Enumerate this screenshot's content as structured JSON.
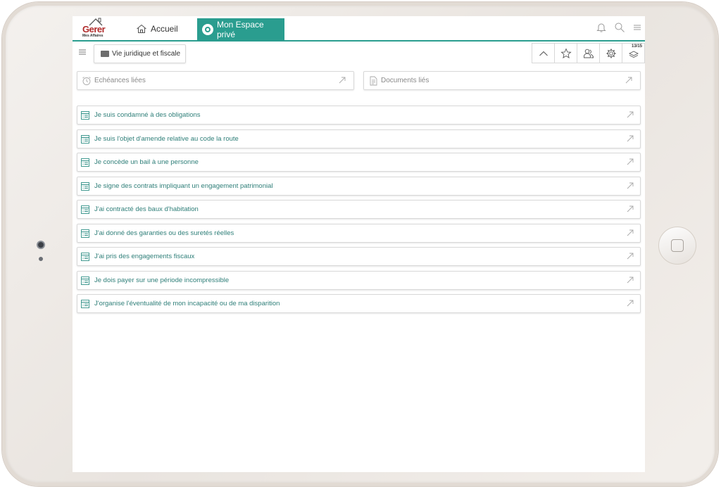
{
  "logo": {
    "brand": "Gerer",
    "tagline": "Mes Affaires"
  },
  "header": {
    "home_label": "Accueil",
    "private_label": "Mon Espace privé",
    "accent_color": "#2a9d8f",
    "icons": [
      "bell-icon",
      "search-icon",
      "hamburger-icon"
    ]
  },
  "toolbar": {
    "breadcrumb": "Vie juridique et fiscale",
    "tools": [
      "chevron-up-icon",
      "star-icon",
      "users-icon",
      "gear-icon",
      "stack-icon"
    ],
    "counter": "13/15"
  },
  "linked": {
    "echeances": "Echéances liées",
    "documents": "Documents liés"
  },
  "items": [
    {
      "label": "Je suis condamné à des obligations"
    },
    {
      "label": "Je suis l'objet d'amende relative au code la route"
    },
    {
      "label": "Je concède un bail à une personne"
    },
    {
      "label": "Je signe des contrats impliquant un engagement patrimonial"
    },
    {
      "label": "J'ai contracté des baux d'habitation"
    },
    {
      "label": "J'ai donné des garanties ou des suretés réelles"
    },
    {
      "label": "J'ai pris des engagements fiscaux"
    },
    {
      "label": "Je dois payer sur une période incompressible"
    },
    {
      "label": "J'organise l'éventualité de mon incapacité ou de ma disparition"
    }
  ]
}
